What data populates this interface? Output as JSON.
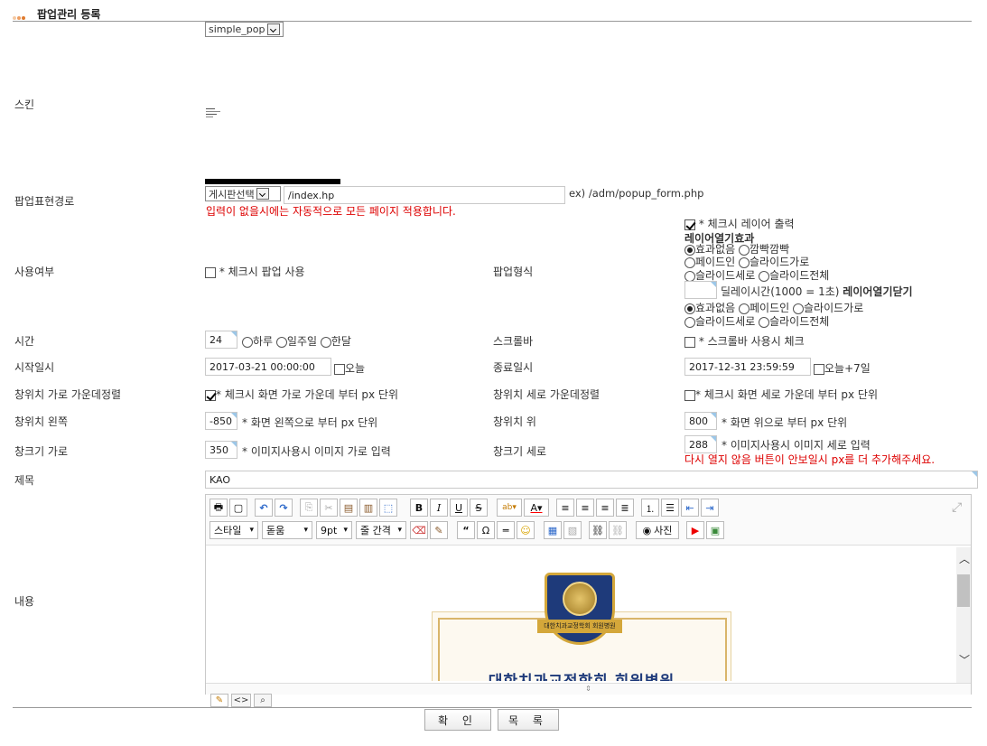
{
  "page_title": "팝업관리 등록",
  "skin": {
    "label": "스킨",
    "value": "simple_pop"
  },
  "path": {
    "label": "팝업표현경로",
    "board_select": "게시판선택",
    "value": "/index.hp",
    "example": "ex) /adm/popup_form.php",
    "note": "입력이 없을시에는 자동적으로 모든 페이지 적용합니다."
  },
  "usage": {
    "label": "사용여부",
    "checkbox": "* 체크시 팝업 사용",
    "checked": false
  },
  "popup_type": {
    "label": "팝업형식",
    "layer_checkbox": "* 체크시 레이어 출력",
    "layer_checked": true,
    "open_effect_title": "레이어열기효과",
    "open_effects": [
      "효과없음",
      "깜빡깜빡",
      "페이드인",
      "슬라이드가로",
      "슬라이드세로",
      "슬라이드전체"
    ],
    "delay_text": "딜레이시간(1000 = 1초)",
    "close_effect_title": "레이어열기닫기",
    "close_effects": [
      "효과없음",
      "페이드인",
      "슬라이드가로",
      "슬라이드세로",
      "슬라이드전체"
    ]
  },
  "time": {
    "label": "시간",
    "value": "24",
    "options": [
      "하루",
      "일주일",
      "한달"
    ]
  },
  "scrollbar": {
    "label": "스크롤바",
    "checkbox": "* 스크롤바 사용시 체크",
    "checked": false
  },
  "start": {
    "label": "시작일시",
    "value": "2017-03-21 00:00:00",
    "today": "오늘"
  },
  "end": {
    "label": "종료일시",
    "value": "2017-12-31 23:59:59",
    "today": "오늘+7일"
  },
  "center_h": {
    "label": "창위치 가로 가운데정렬",
    "checkbox": "* 체크시 화면 가로 가운데 부터 px 단위",
    "checked": true
  },
  "center_v": {
    "label": "창위치 세로 가운데정렬",
    "checkbox": "* 체크시 화면 세로 가운데 부터 px 단위",
    "checked": false
  },
  "left": {
    "label": "창위치 왼쪽",
    "value": "-850",
    "hint": "* 화면 왼쪽으로 부터 px 단위"
  },
  "top": {
    "label": "창위치 위",
    "value": "800",
    "hint": "* 화면 위으로 부터 px 단위"
  },
  "width": {
    "label": "창크기 가로",
    "value": "350",
    "hint": "* 이미지사용시 이미지 가로 입력"
  },
  "height": {
    "label": "창크기 세로",
    "value": "288",
    "hint": "* 이미지사용시 이미지 세로 입력",
    "note": "다시 열지 않음 버튼이 안보일시 px를 더 추가해주세요."
  },
  "subject": {
    "label": "제목",
    "value": "KAO"
  },
  "content": {
    "label": "내용",
    "toolbar": {
      "style": "스타일",
      "font": "돋움",
      "size": "9pt",
      "line": "줄 간격",
      "photo": "사진"
    },
    "banner_text": "대한치과교정학회 회원병원",
    "badge_text": "대한치과교정학회 회원병원"
  },
  "buttons": {
    "confirm": "확 인",
    "list": "목 록"
  },
  "colors": {
    "accent": "#e98c4a",
    "red": "#dd0000",
    "badge_blue": "#1e3a7a",
    "badge_gold": "#d4a73a"
  }
}
